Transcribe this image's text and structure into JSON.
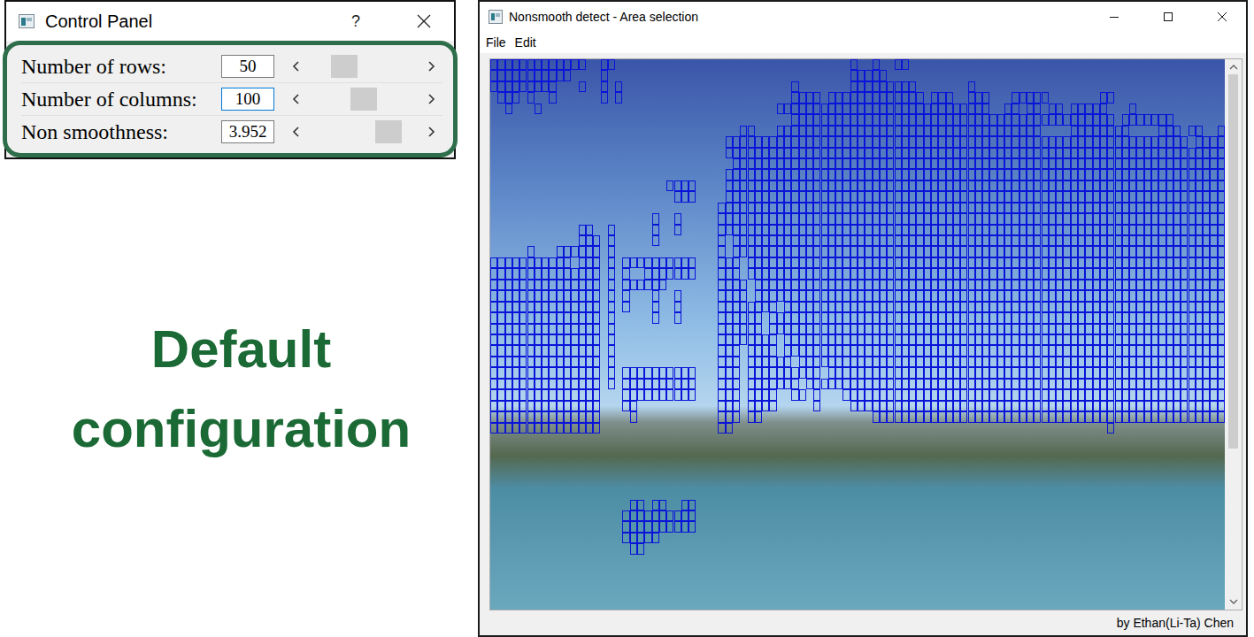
{
  "control_panel": {
    "title": "Control Panel",
    "help": "?",
    "rows": [
      {
        "label": "Number of rows:",
        "value": "50",
        "focused": false,
        "level": 0.26
      },
      {
        "label": "Number of columns:",
        "value": "100",
        "focused": true,
        "level": 0.5
      },
      {
        "label": "Non smoothness:",
        "value": "3.952",
        "focused": false,
        "level": 0.8
      }
    ]
  },
  "caption": [
    "Default",
    "configuration"
  ],
  "window": {
    "title": "Nonsmooth detect - Area selection"
  },
  "menu": [
    {
      "label": "File"
    },
    {
      "label": "Edit"
    }
  ],
  "viewer": {
    "grid_rows": 50,
    "grid_columns": 100,
    "scrollbar": {
      "position": 0,
      "thumb_share": 0.72
    },
    "selected": [
      [
        0,
        0,
        12
      ],
      [
        0,
        15,
        16
      ],
      [
        0,
        49,
        49
      ],
      [
        0,
        52,
        52
      ],
      [
        0,
        55,
        56
      ],
      [
        1,
        0,
        10
      ],
      [
        1,
        15,
        15
      ],
      [
        1,
        49,
        53
      ],
      [
        2,
        0,
        8
      ],
      [
        2,
        12,
        12
      ],
      [
        2,
        15,
        15
      ],
      [
        2,
        17,
        17
      ],
      [
        2,
        41,
        41
      ],
      [
        2,
        49,
        57
      ],
      [
        2,
        65,
        65
      ],
      [
        3,
        1,
        3
      ],
      [
        3,
        5,
        5
      ],
      [
        3,
        8,
        8
      ],
      [
        3,
        15,
        15
      ],
      [
        3,
        17,
        17
      ],
      [
        3,
        41,
        44
      ],
      [
        3,
        46,
        58
      ],
      [
        3,
        60,
        62
      ],
      [
        3,
        65,
        67
      ],
      [
        3,
        71,
        75
      ],
      [
        3,
        83,
        84
      ],
      [
        4,
        2,
        2
      ],
      [
        4,
        6,
        6
      ],
      [
        4,
        39,
        67
      ],
      [
        4,
        70,
        71
      ],
      [
        4,
        73,
        74
      ],
      [
        4,
        76,
        77
      ],
      [
        4,
        79,
        83
      ],
      [
        4,
        87,
        87
      ],
      [
        5,
        41,
        84
      ],
      [
        5,
        86,
        92
      ],
      [
        6,
        34,
        35
      ],
      [
        6,
        39,
        74
      ],
      [
        6,
        79,
        86
      ],
      [
        6,
        91,
        93
      ],
      [
        6,
        95,
        96
      ],
      [
        6,
        99,
        99
      ],
      [
        7,
        32,
        94
      ],
      [
        7,
        96,
        99
      ],
      [
        8,
        32,
        99
      ],
      [
        9,
        33,
        99
      ],
      [
        10,
        32,
        99
      ],
      [
        11,
        24,
        27
      ],
      [
        11,
        32,
        99
      ],
      [
        12,
        25,
        27
      ],
      [
        12,
        32,
        99
      ],
      [
        13,
        31,
        99
      ],
      [
        14,
        22,
        22
      ],
      [
        14,
        25,
        25
      ],
      [
        14,
        31,
        99
      ],
      [
        15,
        12,
        13
      ],
      [
        15,
        16,
        16
      ],
      [
        15,
        22,
        22
      ],
      [
        15,
        25,
        25
      ],
      [
        15,
        31,
        99
      ],
      [
        16,
        12,
        14
      ],
      [
        16,
        16,
        16
      ],
      [
        16,
        22,
        22
      ],
      [
        16,
        31,
        31
      ],
      [
        16,
        33,
        99
      ],
      [
        17,
        5,
        5
      ],
      [
        17,
        9,
        14
      ],
      [
        17,
        16,
        16
      ],
      [
        17,
        31,
        31
      ],
      [
        17,
        33,
        99
      ],
      [
        18,
        0,
        10
      ],
      [
        18,
        12,
        14
      ],
      [
        18,
        16,
        16
      ],
      [
        18,
        18,
        27
      ],
      [
        18,
        31,
        33
      ],
      [
        18,
        35,
        99
      ],
      [
        19,
        0,
        14
      ],
      [
        19,
        16,
        16
      ],
      [
        19,
        18,
        18
      ],
      [
        19,
        21,
        27
      ],
      [
        19,
        31,
        33
      ],
      [
        19,
        35,
        99
      ],
      [
        20,
        0,
        14
      ],
      [
        20,
        16,
        16
      ],
      [
        20,
        18,
        23
      ],
      [
        20,
        31,
        34
      ],
      [
        20,
        36,
        99
      ],
      [
        21,
        0,
        14
      ],
      [
        21,
        16,
        16
      ],
      [
        21,
        18,
        18
      ],
      [
        21,
        22,
        22
      ],
      [
        21,
        25,
        25
      ],
      [
        21,
        31,
        34
      ],
      [
        21,
        36,
        99
      ],
      [
        22,
        0,
        14
      ],
      [
        22,
        16,
        16
      ],
      [
        22,
        18,
        18
      ],
      [
        22,
        22,
        22
      ],
      [
        22,
        25,
        25
      ],
      [
        22,
        31,
        38
      ],
      [
        22,
        40,
        99
      ],
      [
        23,
        0,
        14
      ],
      [
        23,
        16,
        16
      ],
      [
        23,
        22,
        22
      ],
      [
        23,
        25,
        25
      ],
      [
        23,
        31,
        36
      ],
      [
        23,
        38,
        99
      ],
      [
        24,
        0,
        14
      ],
      [
        24,
        16,
        16
      ],
      [
        24,
        31,
        36
      ],
      [
        24,
        38,
        99
      ],
      [
        25,
        0,
        14
      ],
      [
        25,
        16,
        16
      ],
      [
        25,
        31,
        38
      ],
      [
        25,
        40,
        99
      ],
      [
        26,
        0,
        14
      ],
      [
        26,
        16,
        16
      ],
      [
        26,
        31,
        33
      ],
      [
        26,
        35,
        38
      ],
      [
        26,
        40,
        99
      ],
      [
        27,
        0,
        14
      ],
      [
        27,
        16,
        16
      ],
      [
        27,
        31,
        33
      ],
      [
        27,
        35,
        40
      ],
      [
        27,
        42,
        99
      ],
      [
        28,
        0,
        14
      ],
      [
        28,
        16,
        16
      ],
      [
        28,
        18,
        27
      ],
      [
        28,
        31,
        33
      ],
      [
        28,
        35,
        44
      ],
      [
        28,
        46,
        99
      ],
      [
        29,
        0,
        14
      ],
      [
        29,
        16,
        16
      ],
      [
        29,
        18,
        27
      ],
      [
        29,
        31,
        33
      ],
      [
        29,
        35,
        41
      ],
      [
        29,
        43,
        99
      ],
      [
        30,
        0,
        14
      ],
      [
        30,
        18,
        27
      ],
      [
        30,
        31,
        33
      ],
      [
        30,
        35,
        38
      ],
      [
        30,
        41,
        42
      ],
      [
        30,
        44,
        44
      ],
      [
        30,
        48,
        99
      ],
      [
        31,
        0,
        14
      ],
      [
        31,
        18,
        19
      ],
      [
        31,
        31,
        33
      ],
      [
        31,
        35,
        38
      ],
      [
        31,
        44,
        44
      ],
      [
        31,
        49,
        99
      ],
      [
        32,
        0,
        14
      ],
      [
        32,
        19,
        19
      ],
      [
        32,
        31,
        33
      ],
      [
        32,
        35,
        36
      ],
      [
        32,
        52,
        99
      ],
      [
        33,
        0,
        14
      ],
      [
        33,
        31,
        32
      ],
      [
        33,
        84,
        84
      ],
      [
        40,
        19,
        20
      ],
      [
        40,
        22,
        23
      ],
      [
        40,
        26,
        27
      ],
      [
        41,
        18,
        27
      ],
      [
        42,
        18,
        27
      ],
      [
        43,
        18,
        22
      ],
      [
        44,
        19,
        20
      ]
    ]
  },
  "status_bar": "by Ethan(Li-Ta) Chen"
}
